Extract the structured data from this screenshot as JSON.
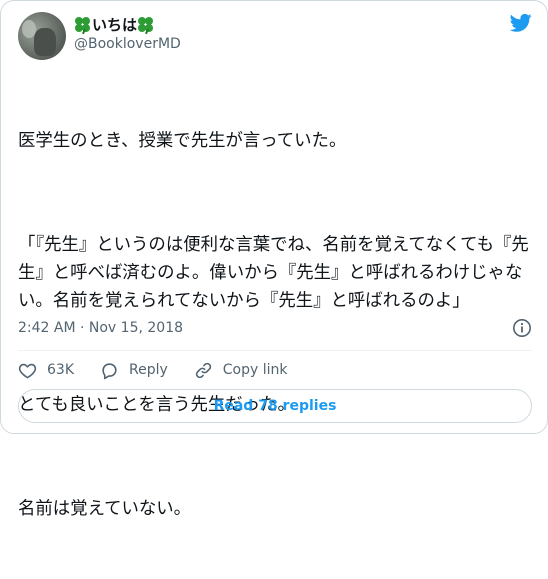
{
  "author": {
    "display_name": "いちは",
    "handle": "@BookloverMD"
  },
  "icons": {
    "avatar": "profile-photo",
    "name_decoration": "four-leaf-clover-icon",
    "brand": "twitter-bird-icon",
    "info": "info-circle-icon",
    "like": "heart-icon",
    "reply": "speech-bubble-icon",
    "copy_link": "link-icon"
  },
  "tweet": {
    "paragraphs": [
      "医学生のとき、授業で先生が言っていた。",
      "「『先生』というのは便利な言葉でね、名前を覚えてなくても『先生』と呼べば済むのよ。偉いから『先生』と呼ばれるわけじゃない。名前を覚えられてないから『先生』と呼ばれるのよ」",
      "とても良いことを言う先生だった。",
      "名前は覚えていない。"
    ],
    "timestamp": "2:42 AM · Nov 15, 2018"
  },
  "actions": {
    "likes_count": "63K",
    "reply_label": "Reply",
    "copy_link_label": "Copy link"
  },
  "read_replies_label": "Read 78 replies",
  "colors": {
    "accent": "#1d9bf0",
    "text": "#0f1419",
    "secondary_text": "#536471",
    "border": "#cfd9de",
    "clover": "#2e9c35"
  }
}
